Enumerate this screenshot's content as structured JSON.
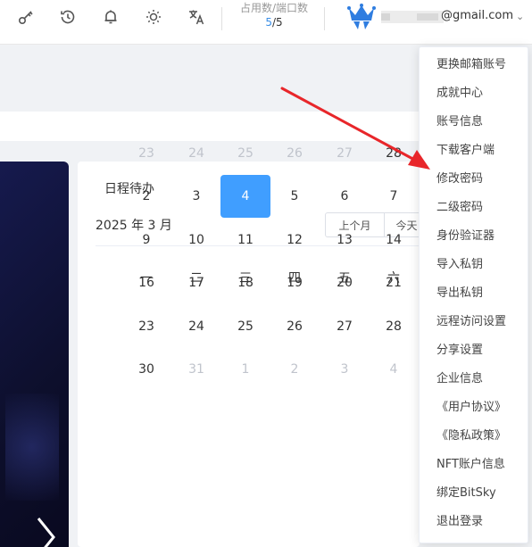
{
  "toolbar": {
    "icons": [
      "key-icon",
      "history-icon",
      "bell-icon",
      "sun-icon",
      "translate-icon"
    ],
    "usage_label": "占用数/端口数",
    "usage_current": "5",
    "usage_separator": "/",
    "usage_total": "5",
    "email": "@gmail.com"
  },
  "calendar": {
    "title": "日程待办",
    "month_label": "2025 年 3 月",
    "prev_button": "上个月",
    "today_button": "今天",
    "weekdays": [
      "一",
      "二",
      "三",
      "四",
      "五",
      "六"
    ],
    "weeks": [
      [
        {
          "d": "23",
          "other": true
        },
        {
          "d": "24",
          "other": true
        },
        {
          "d": "25",
          "other": true
        },
        {
          "d": "26",
          "other": true
        },
        {
          "d": "27",
          "other": true
        },
        {
          "d": "28",
          "other": false
        }
      ],
      [
        {
          "d": "2"
        },
        {
          "d": "3"
        },
        {
          "d": "4",
          "selected": true
        },
        {
          "d": "5"
        },
        {
          "d": "6"
        },
        {
          "d": "7"
        }
      ],
      [
        {
          "d": "9"
        },
        {
          "d": "10"
        },
        {
          "d": "11"
        },
        {
          "d": "12"
        },
        {
          "d": "13"
        },
        {
          "d": "14"
        }
      ],
      [
        {
          "d": "16"
        },
        {
          "d": "17"
        },
        {
          "d": "18"
        },
        {
          "d": "19"
        },
        {
          "d": "20"
        },
        {
          "d": "21"
        }
      ],
      [
        {
          "d": "23"
        },
        {
          "d": "24"
        },
        {
          "d": "25"
        },
        {
          "d": "26"
        },
        {
          "d": "27"
        },
        {
          "d": "28"
        }
      ],
      [
        {
          "d": "30"
        },
        {
          "d": "31",
          "other": true
        },
        {
          "d": "1",
          "other": true
        },
        {
          "d": "2",
          "other": true
        },
        {
          "d": "3",
          "other": true
        },
        {
          "d": "4",
          "other": true
        }
      ]
    ]
  },
  "menu": {
    "items": [
      "更换邮箱账号",
      "成就中心",
      "账号信息",
      "下载客户端",
      "修改密码",
      "二级密码",
      "身份验证器",
      "导入私钥",
      "导出私钥",
      "远程访问设置",
      "分享设置",
      "企业信息",
      "《用户协议》",
      "《隐私政策》",
      "NFT账户信息",
      "绑定BitSky",
      "退出登录"
    ]
  },
  "colors": {
    "accent": "#409eff",
    "annotation_arrow": "#e8262a",
    "banner_dark": "#0d0f2c",
    "crown": "#2f7de0"
  }
}
